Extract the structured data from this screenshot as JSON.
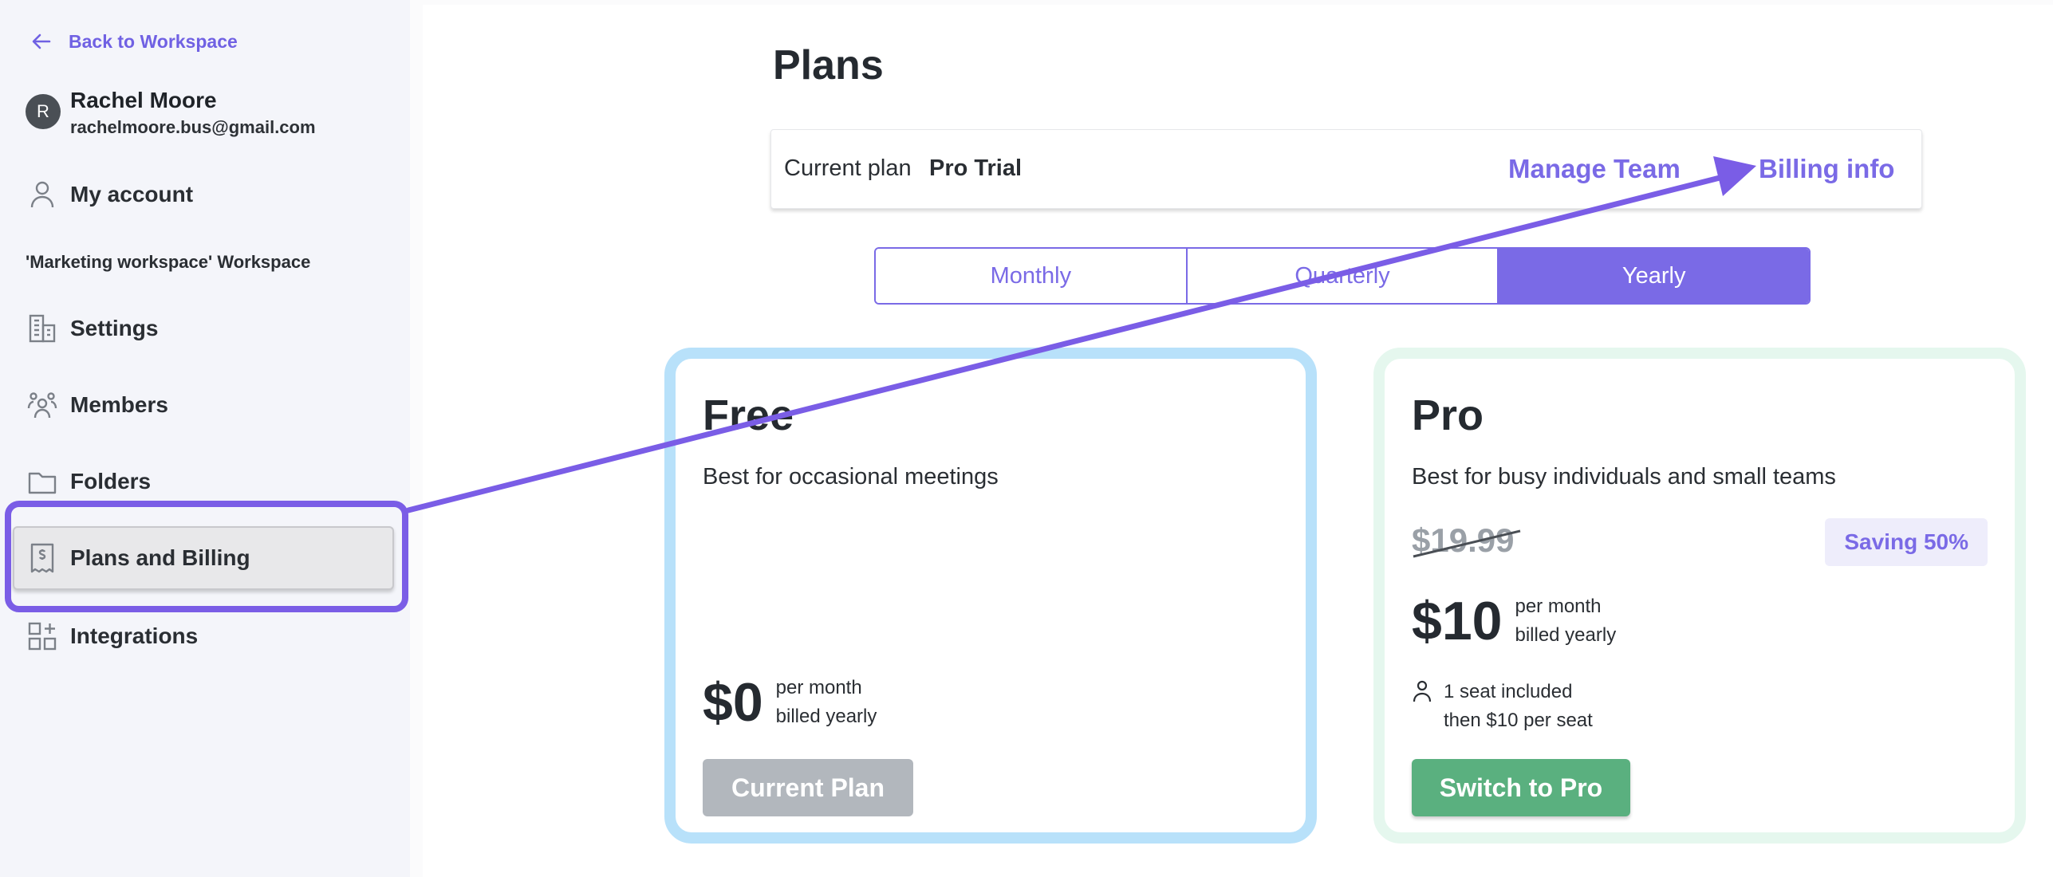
{
  "sidebar": {
    "back_label": "Back to Workspace",
    "user": {
      "initial": "R",
      "name": "Rachel Moore",
      "email": "rachelmoore.bus@gmail.com"
    },
    "my_account": "My account",
    "workspace_label": "'Marketing workspace' Workspace",
    "items": [
      {
        "label": "Settings",
        "icon": "building-icon"
      },
      {
        "label": "Members",
        "icon": "members-icon"
      },
      {
        "label": "Folders",
        "icon": "folder-icon"
      },
      {
        "label": "Plans and Billing",
        "icon": "receipt-dollar-icon",
        "selected": true
      },
      {
        "label": "Integrations",
        "icon": "grid-plus-icon"
      }
    ]
  },
  "main": {
    "title": "Plans",
    "plan_bar": {
      "label": "Current plan",
      "value": "Pro Trial",
      "manage_team": "Manage Team",
      "billing_info": "Billing info"
    },
    "billing_periods": [
      "Monthly",
      "Quarterly",
      "Yearly"
    ],
    "selected_period": "Yearly",
    "plans": {
      "free": {
        "name": "Free",
        "description": "Best for occasional meetings",
        "price": "$0",
        "price_note_1": "per month",
        "price_note_2": "billed yearly",
        "button": "Current Plan"
      },
      "pro": {
        "name": "Pro",
        "description": "Best for busy individuals and small teams",
        "old_price": "$19.99",
        "saving": "Saving 50%",
        "price": "$10",
        "price_note_1": "per month",
        "price_note_2": "billed yearly",
        "seat_1": "1 seat included",
        "seat_2": "then $10 per seat",
        "button": "Switch to Pro"
      }
    }
  },
  "colors": {
    "accent": "#7a6ae6",
    "annotation": "#7a5de6",
    "free_border": "#b8e1fa",
    "pro_border": "#e5f7ee",
    "switch_button": "#5ab07f",
    "current_button": "#b2b7bd"
  }
}
